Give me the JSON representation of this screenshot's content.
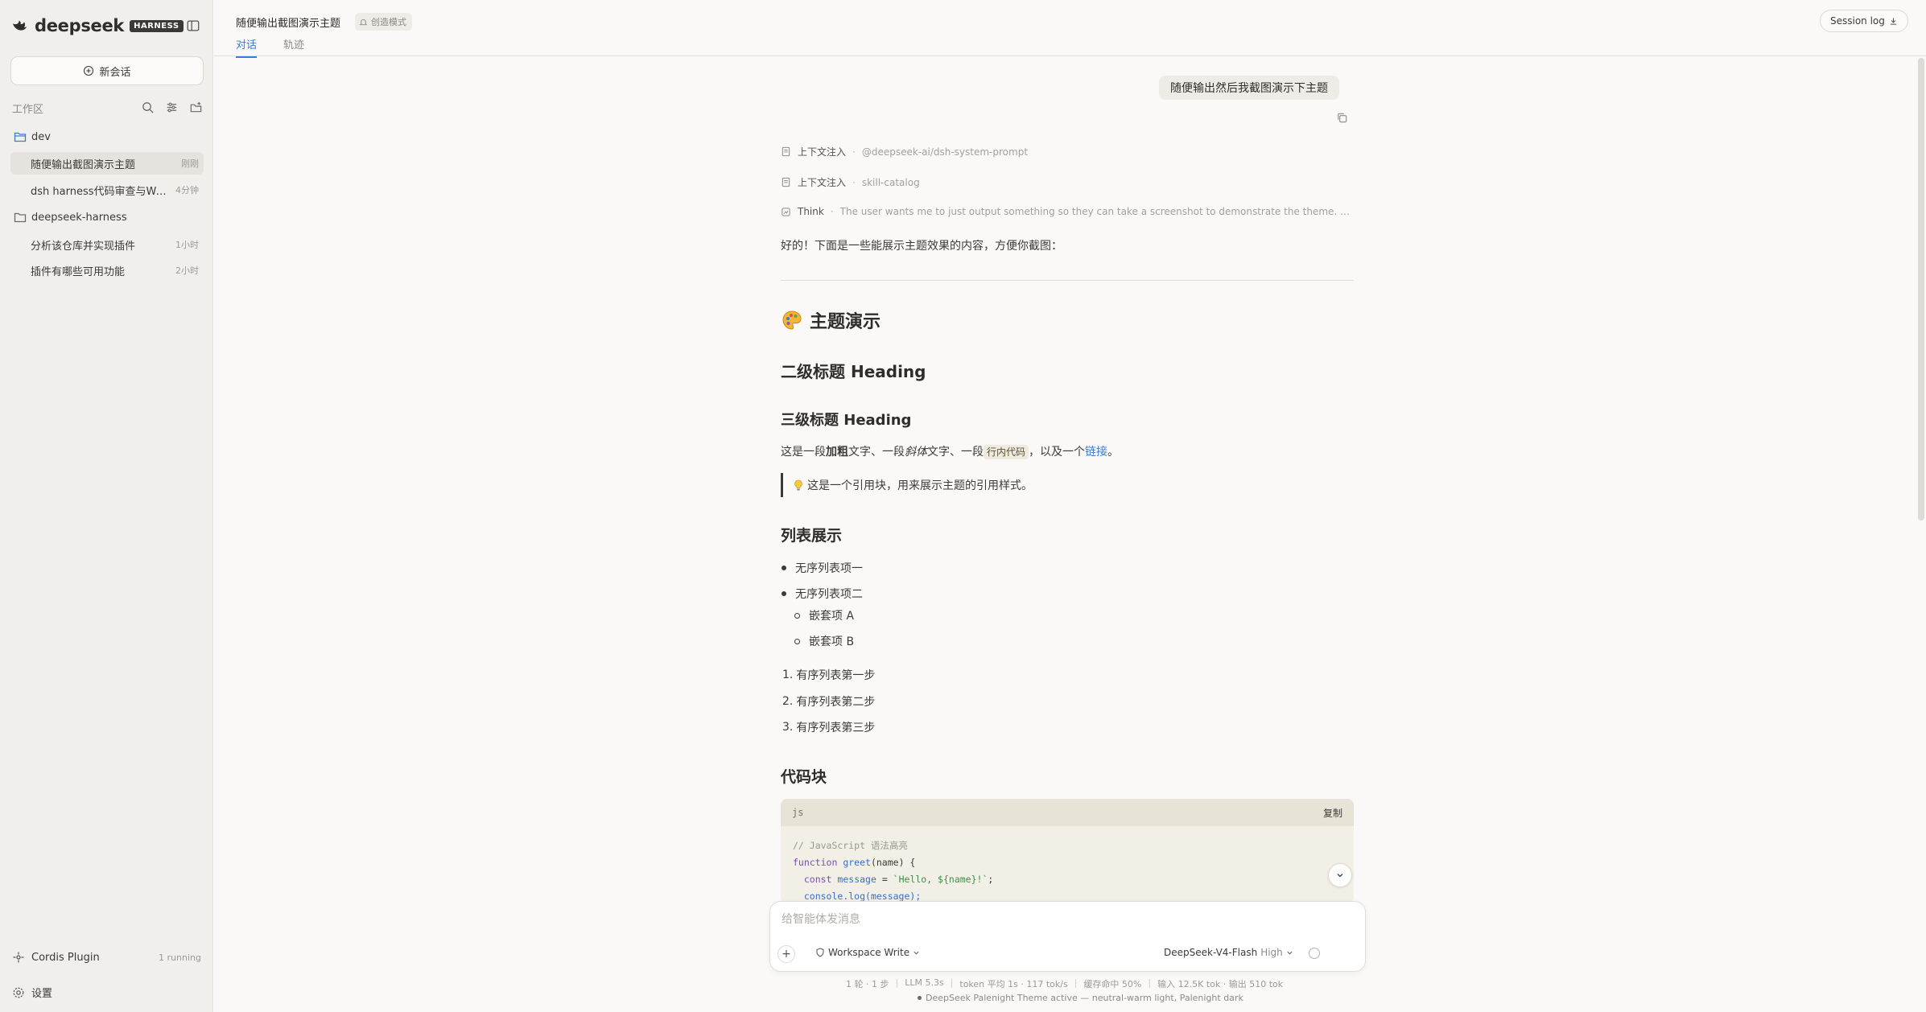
{
  "brand": {
    "name": "deepseek",
    "badge": "HARNESS"
  },
  "sidebar": {
    "new_chat_label": "新会话",
    "workspace_label": "工作区",
    "folders": [
      {
        "name": "dev",
        "sessions": [
          {
            "title": "随便输出截图演示主题",
            "time": "刚刚"
          },
          {
            "title": "dsh harness代码审查与Web...",
            "time": "4分钟"
          }
        ]
      },
      {
        "name": "deepseek-harness",
        "sessions": [
          {
            "title": "分析该仓库并实现插件",
            "time": "1小时"
          },
          {
            "title": "插件有哪些可用功能",
            "time": "2小时"
          }
        ]
      }
    ],
    "plugin": {
      "label": "Cordis Plugin",
      "status": "1 running"
    },
    "settings_label": "设置"
  },
  "topbar": {
    "title": "随便输出截图演示主题",
    "mode": "创造模式",
    "tabs": [
      "对话",
      "轨迹"
    ],
    "session_log": "Session log"
  },
  "chat": {
    "user_message": "随便输出然后我截图演示下主题",
    "meta": [
      {
        "label": "上下文注入",
        "value": "@deepseek-ai/dsh-system-prompt"
      },
      {
        "label": "上下文注入",
        "value": "skill-catalog"
      },
      {
        "label": "Think",
        "value": "The user wants me to just output something so they can take a screenshot to demonstrate the theme. This i..."
      }
    ],
    "intro": "好的！下面是一些能展示主题效果的内容，方便你截图：",
    "h1": "主题演示",
    "h2": "二级标题 Heading",
    "h3": "三级标题 Heading",
    "para": {
      "p1": "这是一段",
      "bold": "加粗",
      "p2": "文字、一段",
      "italic": "斜体",
      "p3": "文字、一段",
      "code": "行内代码",
      "p4": "，以及一个",
      "link": "链接",
      "p5": "。"
    },
    "quote": "这是一个引用块，用来展示主题的引用样式。",
    "list_heading": "列表展示",
    "ul": [
      "无序列表项一",
      "无序列表项二"
    ],
    "nested": [
      "嵌套项 A",
      "嵌套项 B"
    ],
    "ol": [
      "有序列表第一步",
      "有序列表第二步",
      "有序列表第三步"
    ],
    "code_heading": "代码块",
    "code": {
      "lang": "js",
      "copy_label": "复制",
      "lines": {
        "comment": "// JavaScript 语法高亮",
        "l2_kw": "function",
        "l2_fn": "greet",
        "l2_rest": "(name) {",
        "l3_kw": "const",
        "l3_var": "message",
        "l3_eq": " = ",
        "l3_str": "`Hello, ${name}!`",
        "l3_end": ";",
        "l4": "console.log(message);"
      }
    }
  },
  "composer": {
    "placeholder": "给智能体发消息",
    "permission": "Workspace Write",
    "model": "DeepSeek-V4-Flash",
    "effort": "High"
  },
  "stats": [
    "1 轮 · 1 步",
    "LLM 5.3s",
    "token 平均 1s · 117 tok/s",
    "缓存命中 50%",
    "输入 12.5K tok · 输出 510 tok"
  ],
  "theme_status": "DeepSeek Palenight Theme active — neutral-warm light, Palenight dark",
  "colors": {
    "accent": "#3a7bd5",
    "sidebar_bg": "#f1efeb",
    "page_bg": "#faf9f7"
  }
}
